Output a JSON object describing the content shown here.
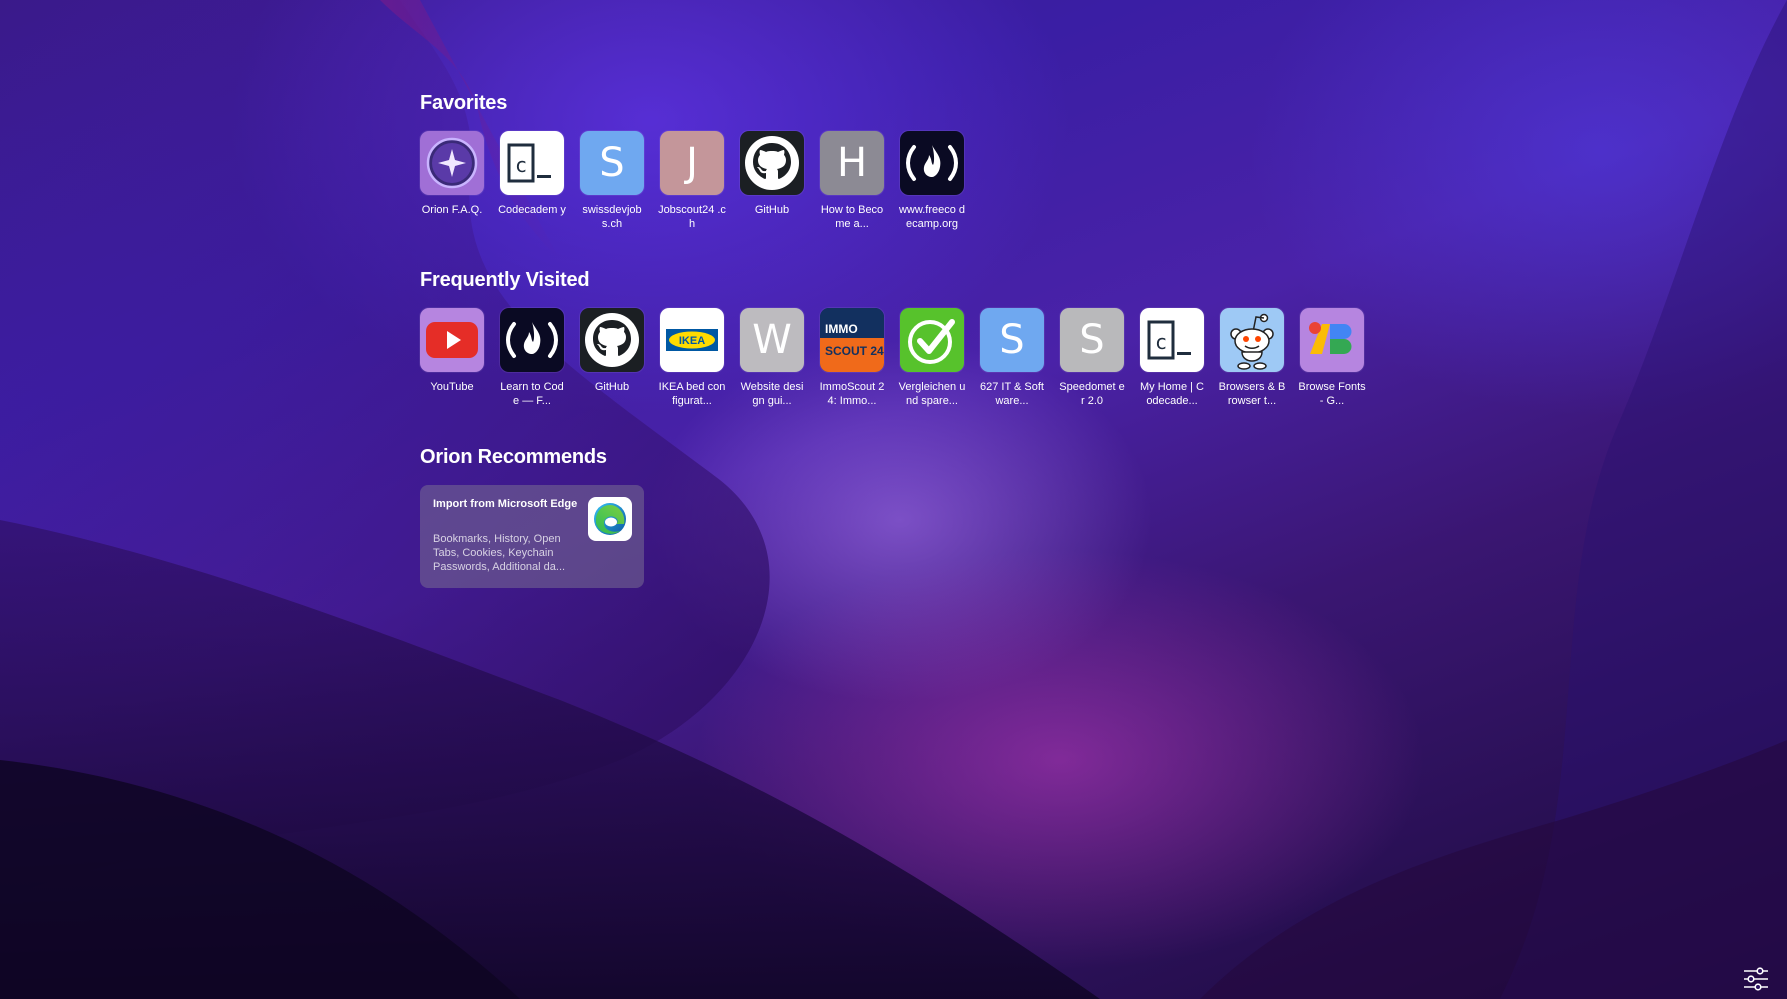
{
  "sections": {
    "favorites": {
      "title": "Favorites",
      "items": [
        {
          "label": "Orion F.A.Q.",
          "icon": "orion-star-icon",
          "bg": "#a06fd6"
        },
        {
          "label": "Codecadem y",
          "icon": "codecademy-icon",
          "bg": "#ffffff"
        },
        {
          "label": "swissdevjob s.ch",
          "icon": "letter-s-icon",
          "letter": "S",
          "bg": "#6fa8f0"
        },
        {
          "label": "Jobscout24 .ch",
          "icon": "letter-j-icon",
          "letter": "J",
          "bg": "#c4969a"
        },
        {
          "label": "GitHub",
          "icon": "github-icon",
          "bg": "#1b1f23"
        },
        {
          "label": "How to Become a...",
          "icon": "letter-h-icon",
          "letter": "H",
          "bg": "#8c8a94"
        },
        {
          "label": "www.freeco decamp.org",
          "icon": "freecodecamp-icon",
          "bg": "#0a0a23"
        }
      ]
    },
    "frequently_visited": {
      "title": "Frequently Visited",
      "items": [
        {
          "label": "YouTube",
          "icon": "youtube-icon",
          "bg": "#b685e0"
        },
        {
          "label": "Learn to Code — F...",
          "icon": "freecodecamp-icon",
          "bg": "#0a0a23"
        },
        {
          "label": "GitHub",
          "icon": "github-icon",
          "bg": "#1b1f23"
        },
        {
          "label": "IKEA bed configurat...",
          "icon": "ikea-icon",
          "bg": "#ffffff"
        },
        {
          "label": "Website design gui...",
          "icon": "letter-w-icon",
          "letter": "W",
          "bg": "#bdbbbf"
        },
        {
          "label": "ImmoScout 24: Immo...",
          "icon": "immoscout-icon",
          "bg": "#0d2a5a"
        },
        {
          "label": "Vergleichen und spare...",
          "icon": "checkmark-icon",
          "bg": "#57c22c"
        },
        {
          "label": "627 IT & Software...",
          "icon": "letter-s-icon",
          "letter": "S",
          "bg": "#6fa8f0"
        },
        {
          "label": "Speedomet er 2.0",
          "icon": "letter-s-icon",
          "letter": "S",
          "bg": "#b9b9bb"
        },
        {
          "label": "My Home | Codecade...",
          "icon": "codecademy-icon",
          "bg": "#ffffff"
        },
        {
          "label": "Browsers & Browser t...",
          "icon": "reddit-icon",
          "bg": "#9ec9f5"
        },
        {
          "label": "Browse Fonts - G...",
          "icon": "google-fonts-icon",
          "bg": "#b685e0"
        }
      ]
    },
    "recommends": {
      "title": "Orion Recommends",
      "card": {
        "title": "Import from Microsoft Edge",
        "description": "Bookmarks, History, Open Tabs, Cookies, Keychain Passwords, Additional da...",
        "icon": "microsoft-edge-icon"
      }
    }
  },
  "settings_icon": "sliders-icon"
}
